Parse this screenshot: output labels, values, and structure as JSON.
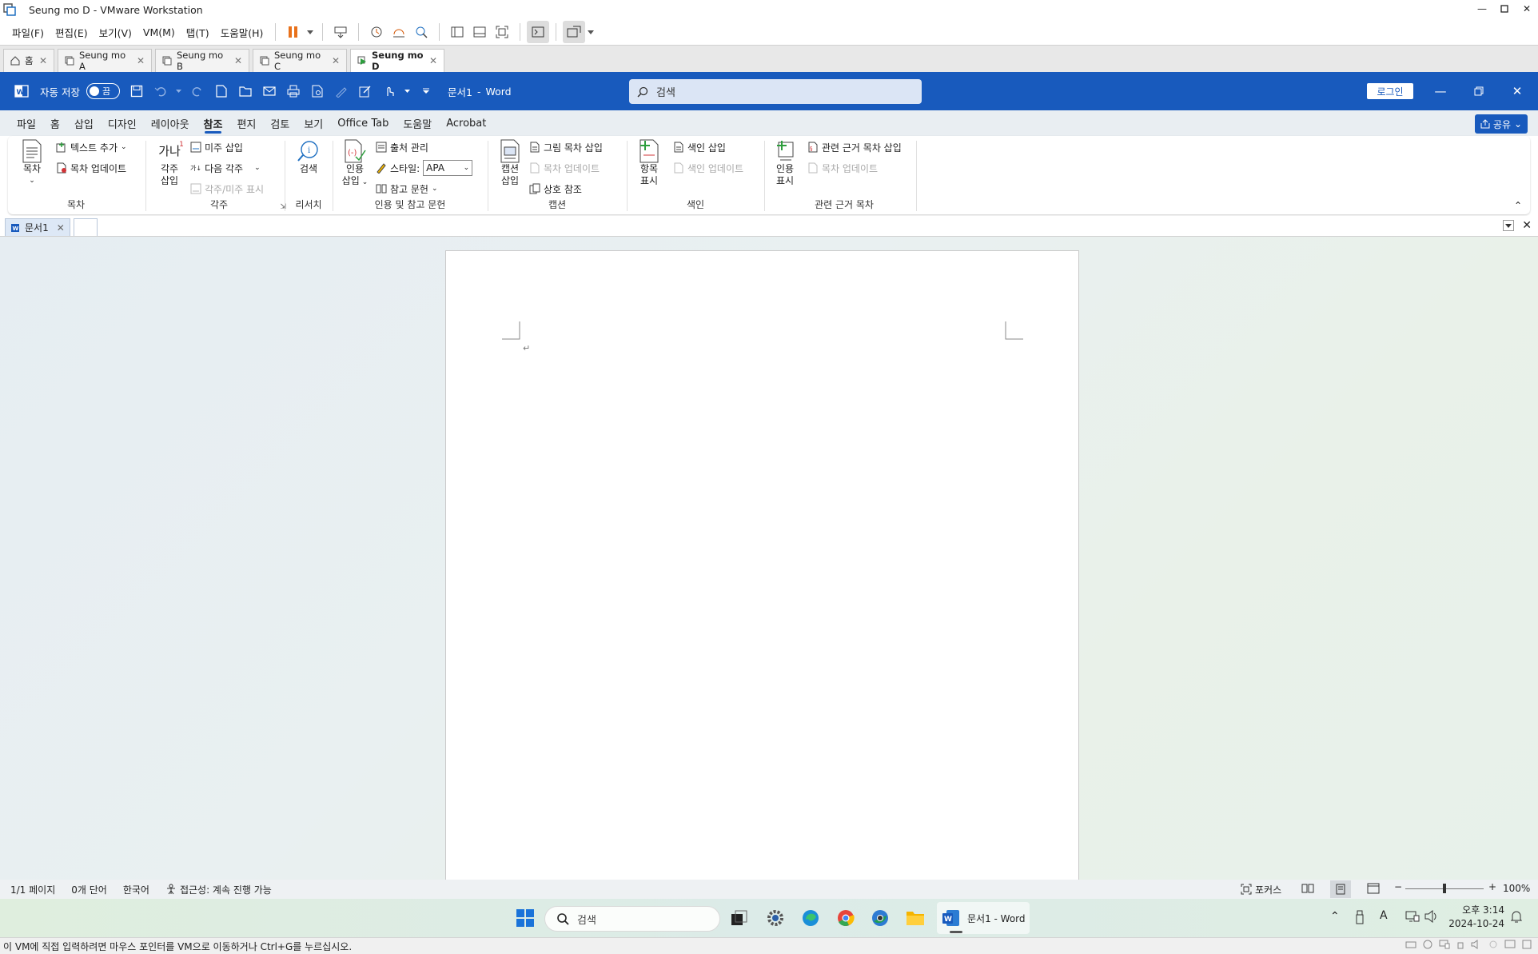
{
  "vmware": {
    "title": "Seung mo D - VMware Workstation",
    "menu": [
      "파일(F)",
      "편집(E)",
      "보기(V)",
      "VM(M)",
      "탭(T)",
      "도움말(H)"
    ],
    "tabs": [
      {
        "label": "홈"
      },
      {
        "label": "Seung mo A"
      },
      {
        "label": "Seung mo B"
      },
      {
        "label": "Seung mo C"
      },
      {
        "label": "Seung mo D"
      }
    ],
    "status_message": "이 VM에 직접 입력하려면 마우스 포인터를 VM으로 이동하거나 Ctrl+G를 누르십시오."
  },
  "word": {
    "autosave_label": "자동 저장",
    "autosave_state": "끔",
    "doc_title": "문서1",
    "app_name": "Word",
    "search_placeholder": "검색",
    "login_label": "로그인",
    "share_label": "공유",
    "tabs": [
      "파일",
      "홈",
      "삽입",
      "디자인",
      "레이아웃",
      "참조",
      "편지",
      "검토",
      "보기",
      "Office Tab",
      "도움말",
      "Acrobat"
    ],
    "ribbon": {
      "toc": {
        "group": "목차",
        "big": "목차",
        "add_text": "텍스트 추가",
        "update_toc": "목차 업데이트"
      },
      "footnotes": {
        "group": "각주",
        "big_line1": "각주",
        "big_line2": "삽입",
        "big_icon": "가나",
        "insert_endnote": "미주 삽입",
        "next_footnote": "다음 각주",
        "show_notes": "각주/미주 표시"
      },
      "research": {
        "group": "리서치",
        "big": "검색"
      },
      "citations": {
        "group": "인용 및 참고 문헌",
        "big_line1": "인용",
        "big_line2": "삽입",
        "manage_sources": "출처 관리",
        "style_label": "스타일:",
        "style_value": "APA",
        "bibliography": "참고 문헌"
      },
      "captions": {
        "group": "캡션",
        "big_line1": "캡션",
        "big_line2": "삽입",
        "insert_tof": "그림 목차 삽입",
        "update_table": "목차 업데이트",
        "cross_ref": "상호 참조"
      },
      "index": {
        "group": "색인",
        "big_line1": "항목",
        "big_line2": "표시",
        "insert_index": "색인 삽입",
        "update_index": "색인 업데이트"
      },
      "toa": {
        "group": "관련 근거 목차",
        "big_line1": "인용",
        "big_line2": "표시",
        "insert_toa": "관련 근거 목차 삽입",
        "update_table": "목차 업데이트"
      }
    },
    "doc_tab": "문서1",
    "status": {
      "page": "1/1 페이지",
      "words": "0개 단어",
      "language": "한국어",
      "accessibility": "접근성: 계속 진행 가능",
      "focus": "포커스",
      "zoom": "100%",
      "zoom_level": 100
    }
  },
  "taskbar": {
    "search_placeholder": "검색",
    "active_app": "문서1 - Word",
    "time": "오후 3:14",
    "date": "2024-10-24"
  },
  "colors": {
    "word_blue": "#185abd",
    "vmware_pause": "#e8711b"
  }
}
